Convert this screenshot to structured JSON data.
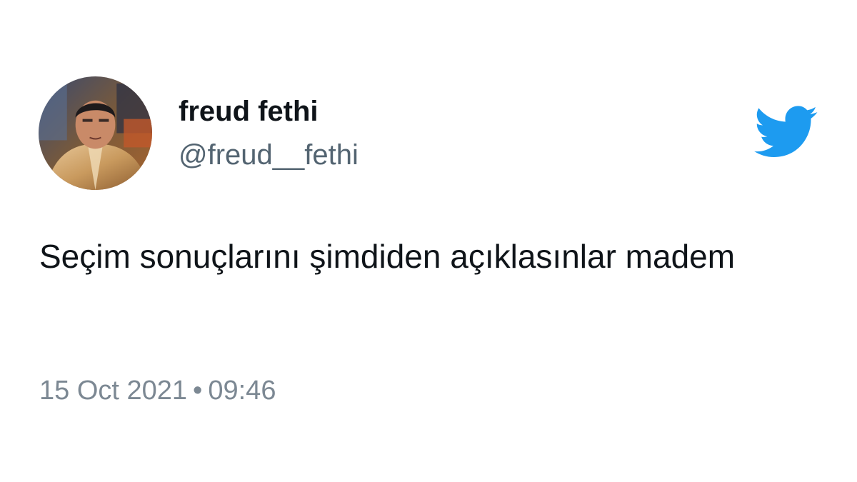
{
  "author": {
    "display_name": "freud fethi",
    "handle": "@freud__fethi",
    "avatar_icon": "profile-photo"
  },
  "tweet": {
    "text": "Seçim sonuçlarını şimdiden açıklasınlar madem"
  },
  "meta": {
    "date": "15 Oct 2021",
    "separator": "•",
    "time": "09:46"
  },
  "brand": {
    "icon": "twitter-bird-icon",
    "color": "#1d9bf0"
  }
}
